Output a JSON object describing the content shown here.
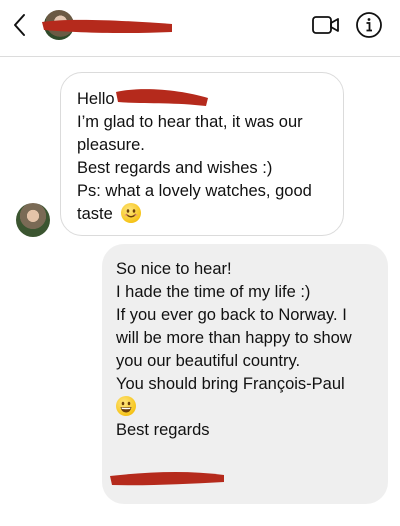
{
  "header": {
    "back_icon": "chevron-left-icon",
    "video_icon": "video-camera-icon",
    "info_icon": "info-icon"
  },
  "incoming_message": {
    "lines": [
      "Hello",
      "I’m glad to hear that, it was our",
      "pleasure.",
      "Best regards and wishes :)",
      "Ps: what a lovely watches, good",
      "taste"
    ],
    "emoji": "smiling-face-emoji"
  },
  "outgoing_message": {
    "lines": [
      "So nice to hear!",
      "I hade the time of my life :)",
      "If you ever go back to Norway. I",
      "will be more than happy to show",
      "you our beautiful country.",
      "You should bring François-Paul",
      "Best regards"
    ],
    "emoji": "grinning-face-emoji"
  },
  "colors": {
    "redaction": "#b52a1c",
    "outgoing_bubble": "#efefef",
    "incoming_border": "#dbdbdb"
  }
}
